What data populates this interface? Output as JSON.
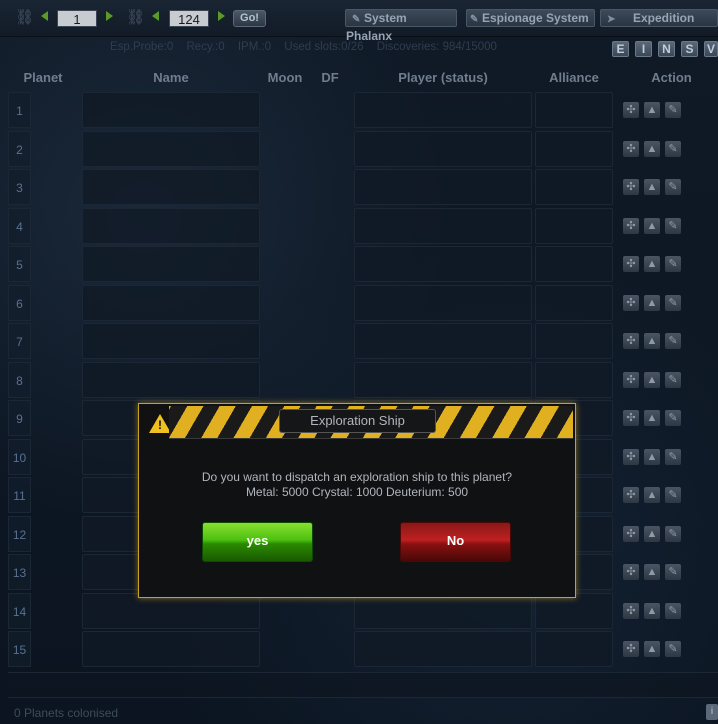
{
  "toolbar": {
    "galaxy_value": "1",
    "system_value": "124",
    "go_label": "Go!",
    "tabs": {
      "system_phalanx": "System Phalanx",
      "espionage_system": "Espionage System",
      "expedition": "Expedition"
    }
  },
  "stats": {
    "esp_probe": "Esp.Probe:0",
    "recy": "Recy.:0",
    "ipm": "IPM.:0",
    "used_slots": "Used slots:0/26",
    "discoveries": "Discoveries: 984/15000"
  },
  "filter_buttons": [
    "E",
    "I",
    "N",
    "S",
    "V"
  ],
  "table": {
    "headers": {
      "planet": "Planet",
      "name": "Name",
      "moon": "Moon",
      "df": "DF",
      "player": "Player (status)",
      "alliance": "Alliance",
      "action": "Action"
    },
    "rows": [
      "1",
      "2",
      "3",
      "4",
      "5",
      "6",
      "7",
      "8",
      "9",
      "10",
      "11",
      "12",
      "13",
      "14",
      "15"
    ]
  },
  "footer": {
    "colonised": "0 Planets colonised",
    "info_btn": "i"
  },
  "dialog": {
    "title": "Exploration Ship",
    "question": "Do you want to dispatch an exploration ship to this planet?",
    "cost": "Metal: 5000 Crystal: 1000 Deuterium: 500",
    "yes_label": "yes",
    "no_label": "No"
  }
}
